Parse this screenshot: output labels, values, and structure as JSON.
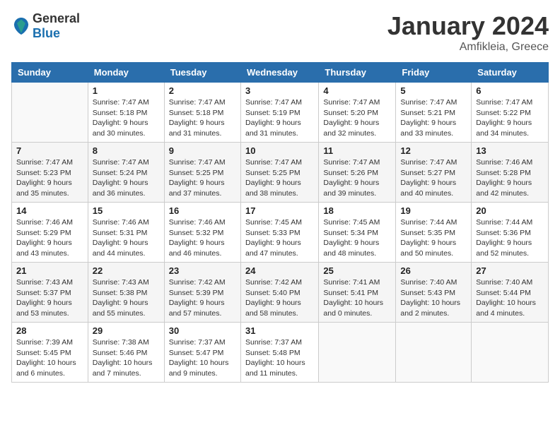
{
  "header": {
    "logo_general": "General",
    "logo_blue": "Blue",
    "month": "January 2024",
    "location": "Amfikleia, Greece"
  },
  "weekdays": [
    "Sunday",
    "Monday",
    "Tuesday",
    "Wednesday",
    "Thursday",
    "Friday",
    "Saturday"
  ],
  "weeks": [
    [
      {
        "date": "",
        "sunrise": "",
        "sunset": "",
        "daylight": ""
      },
      {
        "date": "1",
        "sunrise": "Sunrise: 7:47 AM",
        "sunset": "Sunset: 5:18 PM",
        "daylight": "Daylight: 9 hours and 30 minutes."
      },
      {
        "date": "2",
        "sunrise": "Sunrise: 7:47 AM",
        "sunset": "Sunset: 5:18 PM",
        "daylight": "Daylight: 9 hours and 31 minutes."
      },
      {
        "date": "3",
        "sunrise": "Sunrise: 7:47 AM",
        "sunset": "Sunset: 5:19 PM",
        "daylight": "Daylight: 9 hours and 31 minutes."
      },
      {
        "date": "4",
        "sunrise": "Sunrise: 7:47 AM",
        "sunset": "Sunset: 5:20 PM",
        "daylight": "Daylight: 9 hours and 32 minutes."
      },
      {
        "date": "5",
        "sunrise": "Sunrise: 7:47 AM",
        "sunset": "Sunset: 5:21 PM",
        "daylight": "Daylight: 9 hours and 33 minutes."
      },
      {
        "date": "6",
        "sunrise": "Sunrise: 7:47 AM",
        "sunset": "Sunset: 5:22 PM",
        "daylight": "Daylight: 9 hours and 34 minutes."
      }
    ],
    [
      {
        "date": "7",
        "sunrise": "Sunrise: 7:47 AM",
        "sunset": "Sunset: 5:23 PM",
        "daylight": "Daylight: 9 hours and 35 minutes."
      },
      {
        "date": "8",
        "sunrise": "Sunrise: 7:47 AM",
        "sunset": "Sunset: 5:24 PM",
        "daylight": "Daylight: 9 hours and 36 minutes."
      },
      {
        "date": "9",
        "sunrise": "Sunrise: 7:47 AM",
        "sunset": "Sunset: 5:25 PM",
        "daylight": "Daylight: 9 hours and 37 minutes."
      },
      {
        "date": "10",
        "sunrise": "Sunrise: 7:47 AM",
        "sunset": "Sunset: 5:25 PM",
        "daylight": "Daylight: 9 hours and 38 minutes."
      },
      {
        "date": "11",
        "sunrise": "Sunrise: 7:47 AM",
        "sunset": "Sunset: 5:26 PM",
        "daylight": "Daylight: 9 hours and 39 minutes."
      },
      {
        "date": "12",
        "sunrise": "Sunrise: 7:47 AM",
        "sunset": "Sunset: 5:27 PM",
        "daylight": "Daylight: 9 hours and 40 minutes."
      },
      {
        "date": "13",
        "sunrise": "Sunrise: 7:46 AM",
        "sunset": "Sunset: 5:28 PM",
        "daylight": "Daylight: 9 hours and 42 minutes."
      }
    ],
    [
      {
        "date": "14",
        "sunrise": "Sunrise: 7:46 AM",
        "sunset": "Sunset: 5:29 PM",
        "daylight": "Daylight: 9 hours and 43 minutes."
      },
      {
        "date": "15",
        "sunrise": "Sunrise: 7:46 AM",
        "sunset": "Sunset: 5:31 PM",
        "daylight": "Daylight: 9 hours and 44 minutes."
      },
      {
        "date": "16",
        "sunrise": "Sunrise: 7:46 AM",
        "sunset": "Sunset: 5:32 PM",
        "daylight": "Daylight: 9 hours and 46 minutes."
      },
      {
        "date": "17",
        "sunrise": "Sunrise: 7:45 AM",
        "sunset": "Sunset: 5:33 PM",
        "daylight": "Daylight: 9 hours and 47 minutes."
      },
      {
        "date": "18",
        "sunrise": "Sunrise: 7:45 AM",
        "sunset": "Sunset: 5:34 PM",
        "daylight": "Daylight: 9 hours and 48 minutes."
      },
      {
        "date": "19",
        "sunrise": "Sunrise: 7:44 AM",
        "sunset": "Sunset: 5:35 PM",
        "daylight": "Daylight: 9 hours and 50 minutes."
      },
      {
        "date": "20",
        "sunrise": "Sunrise: 7:44 AM",
        "sunset": "Sunset: 5:36 PM",
        "daylight": "Daylight: 9 hours and 52 minutes."
      }
    ],
    [
      {
        "date": "21",
        "sunrise": "Sunrise: 7:43 AM",
        "sunset": "Sunset: 5:37 PM",
        "daylight": "Daylight: 9 hours and 53 minutes."
      },
      {
        "date": "22",
        "sunrise": "Sunrise: 7:43 AM",
        "sunset": "Sunset: 5:38 PM",
        "daylight": "Daylight: 9 hours and 55 minutes."
      },
      {
        "date": "23",
        "sunrise": "Sunrise: 7:42 AM",
        "sunset": "Sunset: 5:39 PM",
        "daylight": "Daylight: 9 hours and 57 minutes."
      },
      {
        "date": "24",
        "sunrise": "Sunrise: 7:42 AM",
        "sunset": "Sunset: 5:40 PM",
        "daylight": "Daylight: 9 hours and 58 minutes."
      },
      {
        "date": "25",
        "sunrise": "Sunrise: 7:41 AM",
        "sunset": "Sunset: 5:41 PM",
        "daylight": "Daylight: 10 hours and 0 minutes."
      },
      {
        "date": "26",
        "sunrise": "Sunrise: 7:40 AM",
        "sunset": "Sunset: 5:43 PM",
        "daylight": "Daylight: 10 hours and 2 minutes."
      },
      {
        "date": "27",
        "sunrise": "Sunrise: 7:40 AM",
        "sunset": "Sunset: 5:44 PM",
        "daylight": "Daylight: 10 hours and 4 minutes."
      }
    ],
    [
      {
        "date": "28",
        "sunrise": "Sunrise: 7:39 AM",
        "sunset": "Sunset: 5:45 PM",
        "daylight": "Daylight: 10 hours and 6 minutes."
      },
      {
        "date": "29",
        "sunrise": "Sunrise: 7:38 AM",
        "sunset": "Sunset: 5:46 PM",
        "daylight": "Daylight: 10 hours and 7 minutes."
      },
      {
        "date": "30",
        "sunrise": "Sunrise: 7:37 AM",
        "sunset": "Sunset: 5:47 PM",
        "daylight": "Daylight: 10 hours and 9 minutes."
      },
      {
        "date": "31",
        "sunrise": "Sunrise: 7:37 AM",
        "sunset": "Sunset: 5:48 PM",
        "daylight": "Daylight: 10 hours and 11 minutes."
      },
      {
        "date": "",
        "sunrise": "",
        "sunset": "",
        "daylight": ""
      },
      {
        "date": "",
        "sunrise": "",
        "sunset": "",
        "daylight": ""
      },
      {
        "date": "",
        "sunrise": "",
        "sunset": "",
        "daylight": ""
      }
    ]
  ]
}
